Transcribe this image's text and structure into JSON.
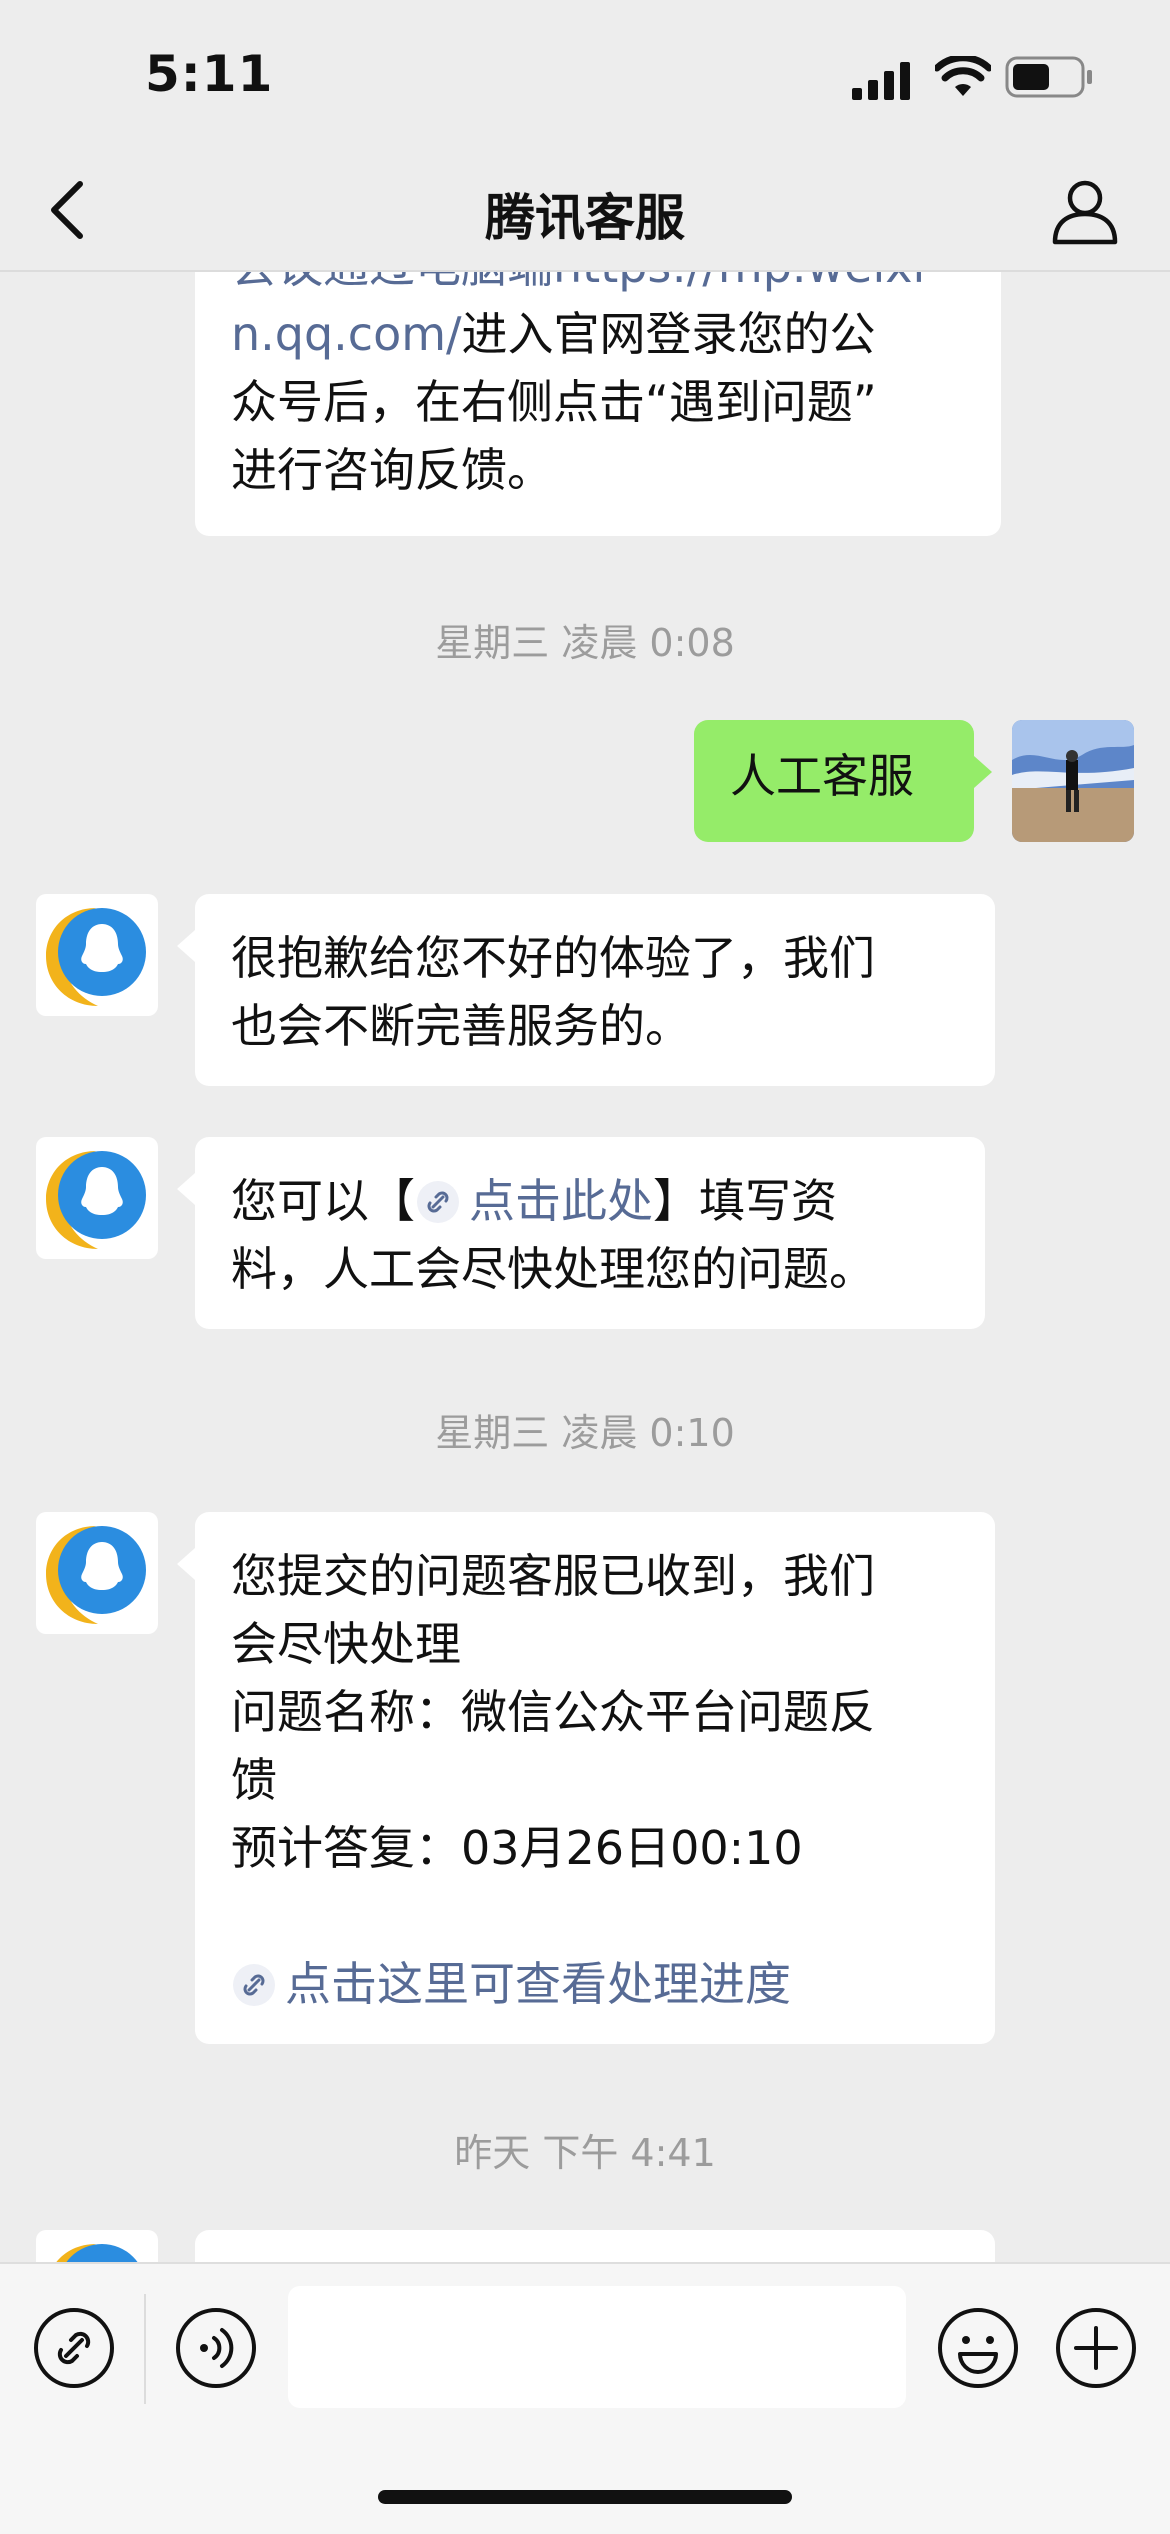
{
  "status": {
    "time": "5:11"
  },
  "nav": {
    "title": "腾讯客服"
  },
  "messages": {
    "m0": {
      "line1": "会议通过电脑端https://mp.weixi",
      "line2_link": "n.qq.com/",
      "line2_text": "进入官网登录您的公",
      "line3": "众号后，在右侧点击“遇到问题”",
      "line4": "进行咨询反馈。"
    },
    "ts1": "星期三 凌晨 0:08",
    "m1": {
      "text": "人工客服"
    },
    "m2": {
      "line1": "很抱歉给您不好的体验了，我们",
      "line2": "也会不断完善服务的。"
    },
    "m3": {
      "prefix": "您可以【",
      "link": "点击此处",
      "suffix": "】填写资",
      "line2": "料，人工会尽快处理您的问题。"
    },
    "ts2": "星期三 凌晨 0:10",
    "m4": {
      "line1": "您提交的问题客服已收到，我们",
      "line2": "会尽快处理",
      "line3": "问题名称：微信公众平台问题反",
      "line4": "馈",
      "line5": "预计答复：03月26日00:10",
      "link": "点击这里可查看处理进度"
    },
    "ts3": "昨天 下午 4:41"
  },
  "input": {
    "placeholder": ""
  },
  "icons": {
    "link": "link-icon",
    "voice": "voice-icon",
    "emoji": "emoji-icon",
    "add": "plus-icon"
  },
  "colors": {
    "background": "#ededed",
    "sent_bubble": "#95ec69",
    "link": "#576b95"
  }
}
